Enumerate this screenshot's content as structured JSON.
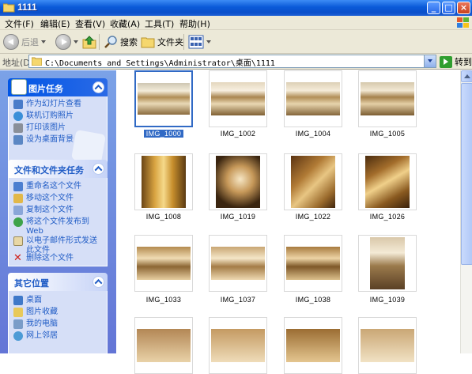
{
  "window": {
    "title": "1111"
  },
  "menu": [
    "文件(F)",
    "编辑(E)",
    "查看(V)",
    "收藏(A)",
    "工具(T)",
    "帮助(H)"
  ],
  "toolbar": {
    "back": "后退",
    "search": "搜索",
    "folders": "文件夹"
  },
  "address": {
    "label": "地址(D)",
    "path": "C:\\Documents and Settings\\Administrator\\桌面\\1111",
    "go": "转到"
  },
  "panels": {
    "picture_tasks": {
      "title": "图片任务",
      "items": [
        {
          "label": "作为幻灯片查看",
          "icon": "slideshow-icon"
        },
        {
          "label": "联机订购照片",
          "icon": "order-prints-icon"
        },
        {
          "label": "打印该图片",
          "icon": "print-icon"
        },
        {
          "label": "设为桌面背景",
          "icon": "desktop-background-icon"
        }
      ]
    },
    "file_tasks": {
      "title": "文件和文件夹任务",
      "items": [
        {
          "label": "重命名这个文件",
          "icon": "rename-icon"
        },
        {
          "label": "移动这个文件",
          "icon": "move-icon"
        },
        {
          "label": "复制这个文件",
          "icon": "copy-icon"
        },
        {
          "label": "将这个文件发布到",
          "label2": "Web",
          "icon": "publish-web-icon"
        },
        {
          "label": "以电子邮件形式发送",
          "label2": "此文件",
          "icon": "email-icon"
        },
        {
          "label": "删除这个文件",
          "icon": "delete-icon"
        }
      ]
    },
    "other_places": {
      "title": "其它位置",
      "items": [
        {
          "label": "桌面",
          "icon": "desktop-icon"
        },
        {
          "label": "图片收藏",
          "icon": "my-pictures-icon"
        },
        {
          "label": "我的电脑",
          "icon": "my-computer-icon"
        },
        {
          "label": "网上邻居",
          "icon": "network-icon"
        }
      ]
    }
  },
  "files": [
    {
      "name": "IMG_1000",
      "selected": true
    },
    {
      "name": "IMG_1002"
    },
    {
      "name": "IMG_1004"
    },
    {
      "name": "IMG_1005"
    },
    {
      "name": "IMG_1008"
    },
    {
      "name": "IMG_1019"
    },
    {
      "name": "IMG_1022"
    },
    {
      "name": "IMG_1026"
    },
    {
      "name": "IMG_1033"
    },
    {
      "name": "IMG_1037"
    },
    {
      "name": "IMG_1038"
    },
    {
      "name": "IMG_1039"
    }
  ],
  "colors": {
    "selection": "#316ac5",
    "pane": "#6375d6",
    "link": "#215dc6"
  }
}
